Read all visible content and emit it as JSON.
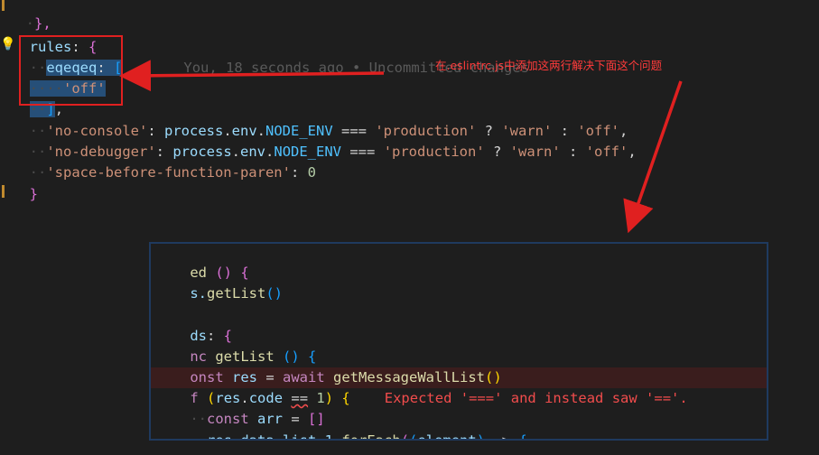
{
  "editor": {
    "line_prev": "},",
    "rules_key": "rules",
    "eqeqeq_key": "eqeqeq",
    "eqeqeq_value": "'off'",
    "no_console_key": "'no-console'",
    "no_debugger_key": "'no-debugger'",
    "space_key": "'space-before-function-paren'",
    "process": "process",
    "env": "env",
    "node_env": "NODE_ENV",
    "production": "'production'",
    "warn": "'warn'",
    "off": "'off'",
    "zero": "0",
    "blame": "You, 18 seconds ago • Uncommitted changes"
  },
  "annotation": {
    "note_text": "在.eslintrc.js中添加这两行解决下面这个问题",
    "color": "#e02020"
  },
  "panel": {
    "l1_a": "ed",
    "l2_a": "s.",
    "l2_fn": "getList",
    "l3_a": "ds",
    "l4_kw": "nc",
    "l4_fn": "getList",
    "l5_kw": "onst",
    "l5_var": "res",
    "l5_await": "await",
    "l5_fn": "getMessageWallList",
    "l6_kw": "f",
    "l6_res": "res",
    "l6_code": "code",
    "l6_num": "1",
    "error_text": "Expected '===' and instead saw '=='.",
    "l7_kw": "const",
    "l7_var": "arr",
    "l8_res": "res",
    "l8_data": "data",
    "l8_list": "list_1",
    "l8_fn": "forEach",
    "l8_param": "element"
  }
}
